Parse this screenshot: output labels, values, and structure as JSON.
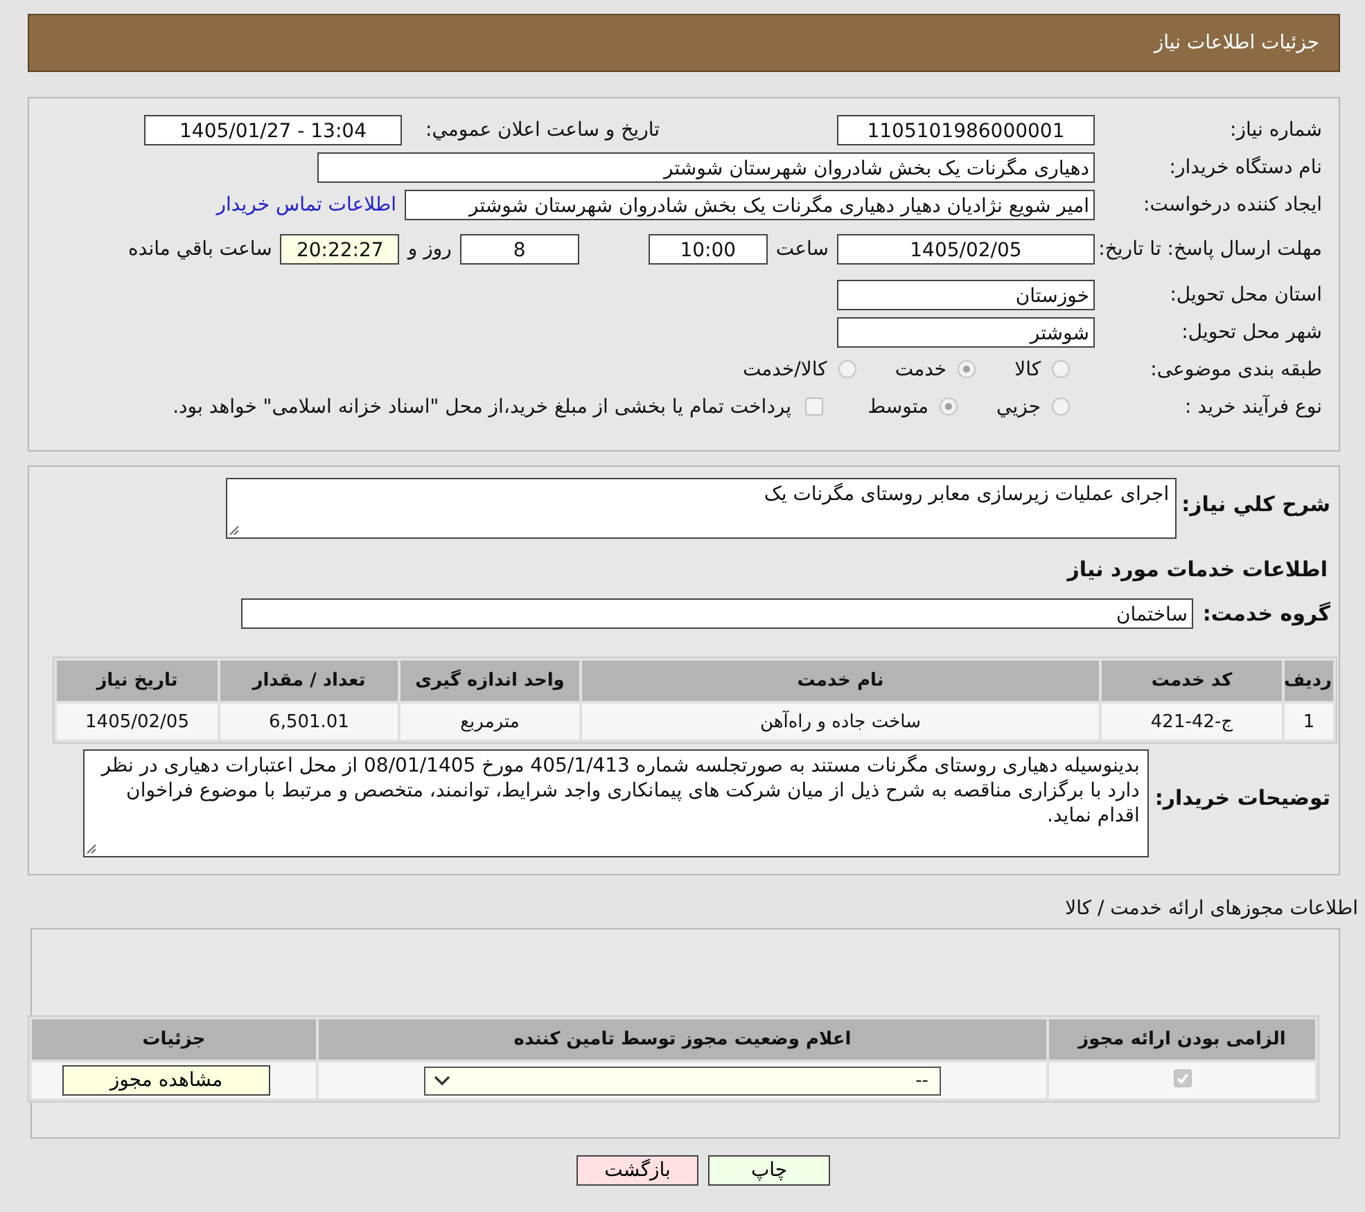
{
  "header": {
    "title": "جزئیات اطلاعات نیاز"
  },
  "details": {
    "need_number": {
      "label": "شماره نیاز:",
      "value": "1105101986000001"
    },
    "announce": {
      "label": "تاریخ و ساعت اعلان عمومي:",
      "value": "1405/01/27 - 13:04"
    },
    "buyer": {
      "label": "نام دستگاه خریدار:",
      "value": "دهیاری مگرنات یک بخش شادروان شهرستان شوشتر"
    },
    "requester": {
      "label": "ایجاد کننده درخواست:",
      "value": "امیر شویع نژادیان دهیار دهیاری مگرنات یک بخش شادروان شهرستان شوشتر",
      "link": "اطلاعات تماس خریدار"
    },
    "deadline": {
      "label": "مهلت ارسال پاسخ: تا تاریخ:",
      "date": "1405/02/05",
      "time_label": "ساعت",
      "time": "10:00",
      "days": "8",
      "days_label": "روز و",
      "remaining": "20:22:27",
      "remaining_label": "ساعت باقي مانده"
    },
    "province": {
      "label": "استان محل تحویل:",
      "value": "خوزستان"
    },
    "city": {
      "label": "شهر محل تحویل:",
      "value": "شوشتر"
    },
    "category": {
      "label": "طبقه بندی موضوعی:",
      "options": [
        {
          "label": "کالا",
          "selected": false
        },
        {
          "label": "خدمت",
          "selected": true
        },
        {
          "label": "کالا/خدمت",
          "selected": false
        }
      ]
    },
    "purchase_type": {
      "label": "نوع فرآیند خرید :",
      "options": [
        {
          "label": "جزیي",
          "selected": false
        },
        {
          "label": "متوسط",
          "selected": true
        }
      ],
      "payment_note": {
        "text": "پرداخت تمام یا بخشی از مبلغ خرید،از محل \"اسناد خزانه اسلامی\" خواهد بود.",
        "checked": false
      }
    }
  },
  "services": {
    "description": {
      "label": "شرح کلي نیاز:",
      "value": "اجرای عملیات زیرسازی معابر روستای مگرنات یک"
    },
    "title": "اطلاعات خدمات مورد نیاز",
    "group": {
      "label": "گروه خدمت:",
      "value": "ساختمان"
    },
    "table": {
      "columns": [
        "ردیف",
        "کد خدمت",
        "نام خدمت",
        "واحد اندازه گیری",
        "تعداد / مقدار",
        "تاریخ نیاز"
      ],
      "rows": [
        [
          "1",
          "ج-42-421",
          "ساخت جاده و راه‌آهن",
          "مترمربع",
          "6,501.01",
          "1405/02/05"
        ]
      ]
    },
    "notes": {
      "label": "توضیحات خریدار:",
      "value": "بدینوسیله دهیاری روستای مگرنات مستند به صورتجلسه شماره 405/1/413 مورخ 08/01/1405 از محل اعتبارات دهیاری در نظر دارد با برگزاری مناقصه به شرح ذیل از میان شرکت های پیمانکاری واجد شرایط، توانمند، متخصص و مرتبط با موضوع فراخوان اقدام نماید."
    }
  },
  "licenses": {
    "title": "اطلاعات مجوزهای ارائه خدمت / کالا",
    "columns": [
      "الزامی بودن ارائه مجوز",
      "اعلام وضعیت مجوز توسط تامین کننده",
      "جزئیات"
    ],
    "rows": [
      {
        "required": true,
        "status": "--",
        "action": "مشاهده مجوز"
      }
    ]
  },
  "buttons": [
    {
      "label": "چاپ",
      "kind": "print"
    },
    {
      "label": "بازگشت",
      "kind": "back"
    }
  ]
}
